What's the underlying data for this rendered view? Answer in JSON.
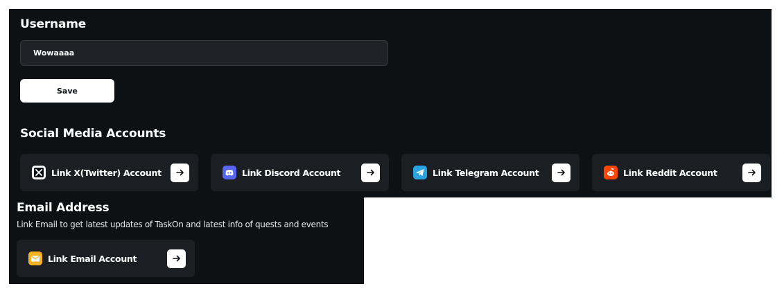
{
  "profile": {
    "username_heading": "Username",
    "username_value": "Wowaaaa",
    "save_label": "Save"
  },
  "social": {
    "heading": "Social Media Accounts",
    "items": [
      {
        "label": "Link X(Twitter) Account",
        "icon": "x-twitter-icon",
        "color": "#ffffff"
      },
      {
        "label": "Link Discord Account",
        "icon": "discord-icon",
        "color": "#5865f2"
      },
      {
        "label": "Link Telegram Account",
        "icon": "telegram-icon",
        "color": "#2aa3e0"
      },
      {
        "label": "Link Reddit Account",
        "icon": "reddit-icon",
        "color": "#ff4500"
      }
    ]
  },
  "email": {
    "heading": "Email Address",
    "description": "Link Email to get latest updates of TaskOn and latest info of quests and events",
    "link_label": "Link Email Account",
    "icon": "email-icon",
    "color": "#f5b324"
  },
  "colors": {
    "panel_bg": "#0d1114",
    "card_bg": "#1b1f23",
    "input_bg": "#1f2327"
  }
}
